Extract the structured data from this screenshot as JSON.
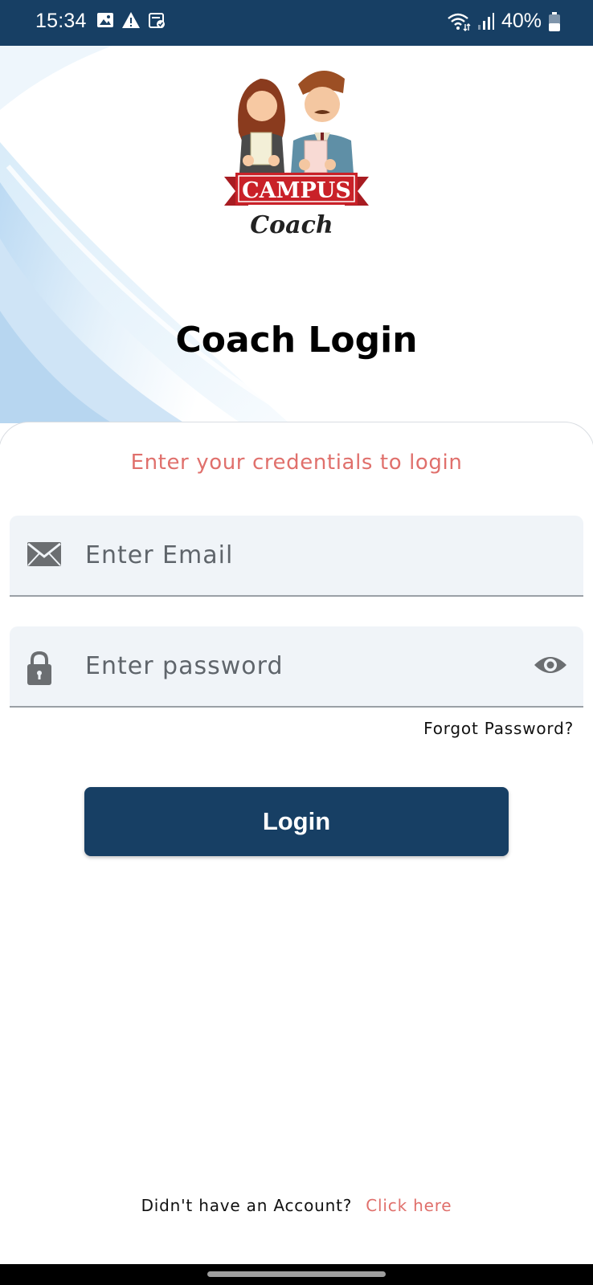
{
  "status_bar": {
    "time": "15:34",
    "battery": "40%",
    "icons": [
      "gallery-icon",
      "warning-icon",
      "calendar-check-icon",
      "wifi-icon",
      "signal-icon",
      "battery-icon"
    ]
  },
  "logo": {
    "line1": "CAMPUS",
    "line2": "Coach"
  },
  "page_title": "Coach Login",
  "subtitle": "Enter your credentials to login",
  "email_field": {
    "placeholder": "Enter Email",
    "icon": "envelope-icon"
  },
  "password_field": {
    "placeholder": "Enter password",
    "icon": "lock-icon",
    "toggle_icon": "eye-icon"
  },
  "forgot_password": "Forgot Password?",
  "login_button": "Login",
  "signup": {
    "question": "Didn't have an Account?",
    "link": "Click here"
  },
  "colors": {
    "primary": "#173f64",
    "accent": "#e0706c",
    "field_bg": "#f0f4f8"
  }
}
